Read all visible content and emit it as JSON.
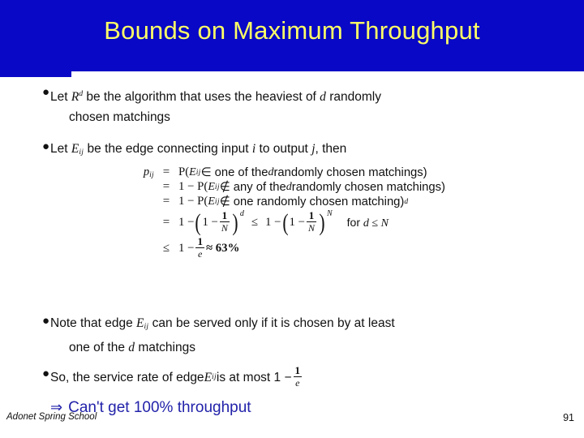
{
  "slide": {
    "title": "Bounds on Maximum Throughput",
    "page_number": "91",
    "footer": "Adonet Spring School",
    "colors": {
      "banner": "#0808c6",
      "title_text": "#ffff66",
      "body_text": "#111111",
      "conclusion_text": "#2222aa",
      "background": "#ffffff"
    }
  },
  "bullets": [
    {
      "marker": "●",
      "line1_pre": "Let ",
      "symbol": "R",
      "symbol_sup": "d",
      "line1_post": " be the algorithm that uses the heaviest of ",
      "var_d": "d",
      "line1_tail": " randomly",
      "line2": "chosen matchings"
    },
    {
      "marker": "●",
      "pre": "Let ",
      "symbol": "E",
      "symbol_sub": "ij",
      "post": " be the edge connecting input ",
      "var_i": "i",
      "mid": " to output ",
      "var_j": "j",
      "tail": ", then"
    },
    {
      "marker": "●",
      "line1_pre": "Note that edge ",
      "symbol": "E",
      "symbol_sub": "ij",
      "line1_post": " can be served only if it is chosen by at least",
      "line2_pre": "one of the ",
      "var_d": "d",
      "line2_post": " matchings"
    },
    {
      "marker": "●",
      "pre": "So, the service rate of edge ",
      "symbol": "E",
      "symbol_sub": "ij",
      "post": " is at most 1 − ",
      "frac_num": "1",
      "frac_den": "e"
    }
  ],
  "equations": {
    "lhs": "p",
    "lhs_sub": "ij",
    "lines": [
      {
        "rel": "=",
        "rhs_pre": "P(",
        "sym": "E",
        "sym_sub": "ij",
        "rhs_mid": " ∈ one of the ",
        "var": "d",
        "rhs_post": " randomly chosen matchings)"
      },
      {
        "rel": "=",
        "rhs_pre": "1 − P(",
        "sym": "E",
        "sym_sub": "ij",
        "rhs_mid": " ∉ any of the ",
        "var": "d",
        "rhs_post": " randomly chosen matchings)"
      },
      {
        "rel": "=",
        "rhs_pre": "1 − P(",
        "sym": "E",
        "sym_sub": "ij",
        "rhs_mid": " ∉ one randomly chosen matching)",
        "var": "",
        "rhs_post": "",
        "exponent": "d"
      }
    ],
    "line4": {
      "rel": "=",
      "lead": "1 −",
      "inner": "1 −",
      "frac_num": "1",
      "frac_den": "N",
      "exp1": "d",
      "rel2": "≤",
      "lead2": "1 −",
      "inner2": "1 −",
      "frac2_num": "1",
      "frac2_den": "N",
      "exp2": "N",
      "note_pre": "for ",
      "note_var1": "d",
      "note_rel": " ≤ ",
      "note_var2": "N"
    },
    "line5": {
      "rel": "≤",
      "lead": "1 −",
      "frac_num": "1",
      "frac_den": "e",
      "tail": "≈ 63%"
    }
  },
  "conclusion": {
    "arrow": "⇒",
    "text": "Can't get 100% throughput"
  }
}
